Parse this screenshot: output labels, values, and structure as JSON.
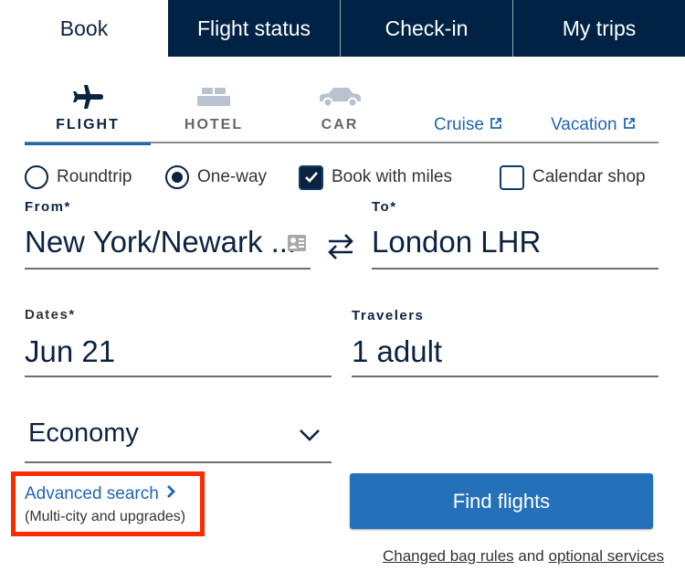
{
  "top_tabs": [
    {
      "label": "Book",
      "active": true
    },
    {
      "label": "Flight status",
      "active": false
    },
    {
      "label": "Check-in",
      "active": false
    },
    {
      "label": "My trips",
      "active": false
    }
  ],
  "product_tabs": [
    {
      "label": "FLIGHT",
      "icon": "airplane-icon",
      "active": true
    },
    {
      "label": "HOTEL",
      "icon": "bed-icon",
      "active": false
    },
    {
      "label": "CAR",
      "icon": "car-icon",
      "active": false
    }
  ],
  "external_links": [
    {
      "label": "Cruise",
      "icon": "external-link-icon"
    },
    {
      "label": "Vacation",
      "icon": "external-link-icon"
    }
  ],
  "trip_options": {
    "roundtrip": {
      "label": "Roundtrip",
      "selected": false
    },
    "oneway": {
      "label": "One-way",
      "selected": true
    },
    "book_with_miles": {
      "label": "Book with miles",
      "checked": true
    },
    "calendar_shop": {
      "label": "Calendar shop",
      "checked": false
    }
  },
  "fields": {
    "from": {
      "label": "From*",
      "value": "New York/Newark ..."
    },
    "to": {
      "label": "To*",
      "value": "London LHR"
    },
    "dates": {
      "label": "Dates*",
      "value": "Jun 21"
    },
    "travelers": {
      "label": "Travelers",
      "value": "1 adult"
    },
    "cabin": {
      "value": "Economy"
    }
  },
  "advanced_search": {
    "label": "Advanced search",
    "sublabel": "(Multi-city and upgrades)"
  },
  "find_flights_label": "Find flights",
  "footer": {
    "link1": "Changed bag rules",
    "connector": " and ",
    "link2": "optional services"
  },
  "colors": {
    "navy": "#002244",
    "link_blue": "#2166b5",
    "button_blue": "#2571b9",
    "highlight_red": "#ff2a00"
  }
}
